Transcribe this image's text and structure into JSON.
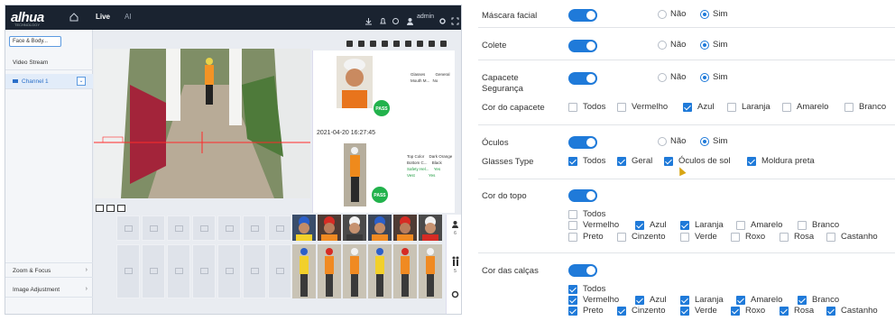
{
  "left": {
    "brand": "alhua",
    "brand_sub": "TECHNOLOGY",
    "tabs": [
      "Live",
      "AI"
    ],
    "user": "admin",
    "mode_select": "Face & Body...",
    "panel": {
      "video_stream": "Video Stream",
      "channel": "Channel 1",
      "zoom_focus": "Zoom & Focus",
      "image_adjustment": "Image Adjustment"
    },
    "face_snapshot": {
      "attributes": [
        [
          "Glasses",
          "General"
        ],
        [
          "Mouth M...",
          "No"
        ]
      ],
      "pass": "PASS"
    },
    "timestamp": "2021-04-20 16:27:45",
    "body_snapshot": {
      "attributes": [
        [
          "Top Color",
          "Dark Orange"
        ],
        [
          "Bottom C...",
          "Black"
        ],
        [
          "Safety Hel...",
          "Yes"
        ],
        [
          "Vest",
          "Yes"
        ]
      ],
      "pass": "PASS"
    },
    "counters": [
      "6",
      "5"
    ]
  },
  "settings": {
    "mascara": {
      "label": "Máscara facial",
      "no": "Não",
      "yes": "Sim"
    },
    "colete": {
      "label": "Colete",
      "no": "Não",
      "yes": "Sim"
    },
    "capacete": {
      "label_line1": "Capacete",
      "label_line2": "Segurança",
      "no": "Não",
      "yes": "Sim"
    },
    "cor_capacete": {
      "label": "Cor do capacete",
      "options": [
        "Todos",
        "Vermelho",
        "Azul",
        "Laranja",
        "Amarelo",
        "Branco"
      ],
      "checked": [
        false,
        false,
        true,
        false,
        false,
        false
      ]
    },
    "oculos": {
      "label": "Óculos",
      "no": "Não",
      "yes": "Sim"
    },
    "glasses_type": {
      "label": "Glasses Type",
      "options": [
        "Todos",
        "Geral",
        "Óculos de sol",
        "Moldura preta"
      ],
      "checked": [
        true,
        true,
        true,
        true
      ]
    },
    "cor_topo": {
      "label": "Cor do topo",
      "all": "Todos",
      "row1": [
        "Vermelho",
        "Azul",
        "Laranja",
        "Amarelo",
        "Branco"
      ],
      "row1_checked": [
        false,
        true,
        true,
        false,
        false
      ],
      "row2": [
        "Preto",
        "Cinzento",
        "Verde",
        "Roxo",
        "Rosa",
        "Castanho"
      ],
      "row2_checked": [
        false,
        false,
        false,
        false,
        false,
        false
      ]
    },
    "cor_calcas": {
      "label": "Cor das calças",
      "all": "Todos",
      "row1": [
        "Vermelho",
        "Azul",
        "Laranja",
        "Amarelo",
        "Branco"
      ],
      "row2": [
        "Preto",
        "Cinzento",
        "Verde",
        "Roxo",
        "Rosa",
        "Castanho"
      ]
    }
  },
  "colors": {
    "accent": "#1f7ad9",
    "topbar": "#1a2330",
    "pass": "#22b24c"
  }
}
